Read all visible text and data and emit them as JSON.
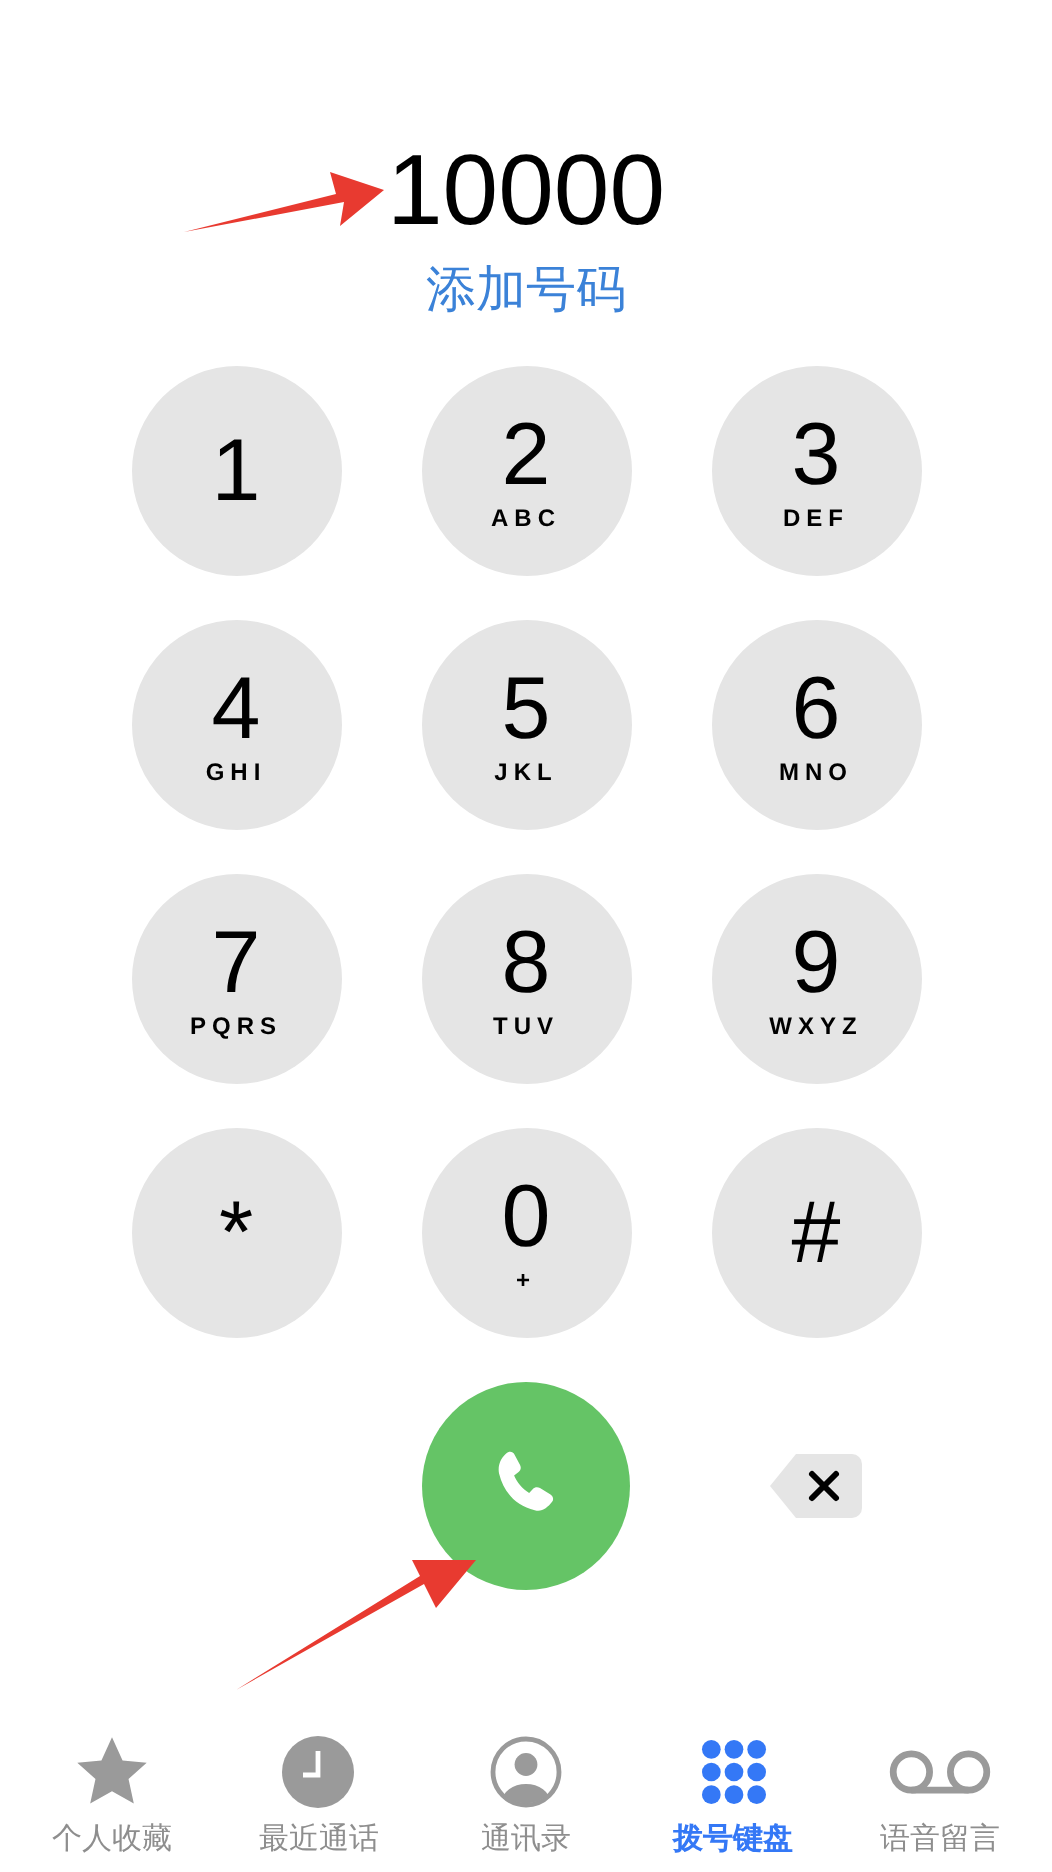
{
  "dialed_number": "10000",
  "add_number_link": "添加号码",
  "keys": [
    {
      "digit": "1"
    },
    {
      "digit": "2",
      "letters": "ABC"
    },
    {
      "digit": "3",
      "letters": "DEF"
    },
    {
      "digit": "4",
      "letters": "GHI"
    },
    {
      "digit": "5",
      "letters": "JKL"
    },
    {
      "digit": "6",
      "letters": "MNO"
    },
    {
      "digit": "7",
      "letters": "PQRS"
    },
    {
      "digit": "8",
      "letters": "TUV"
    },
    {
      "digit": "9",
      "letters": "WXYZ"
    },
    {
      "digit": "*"
    },
    {
      "digit": "0",
      "letters": "+"
    },
    {
      "digit": "#"
    }
  ],
  "tabs": [
    {
      "kind": "star",
      "label": "个人收藏",
      "selected": false
    },
    {
      "kind": "clock",
      "label": "最近通话",
      "selected": false
    },
    {
      "kind": "contact",
      "label": "通讯录",
      "selected": false
    },
    {
      "kind": "keypad",
      "label": "拨号键盘",
      "selected": true
    },
    {
      "kind": "voicemail",
      "label": "语音留言",
      "selected": false
    }
  ]
}
